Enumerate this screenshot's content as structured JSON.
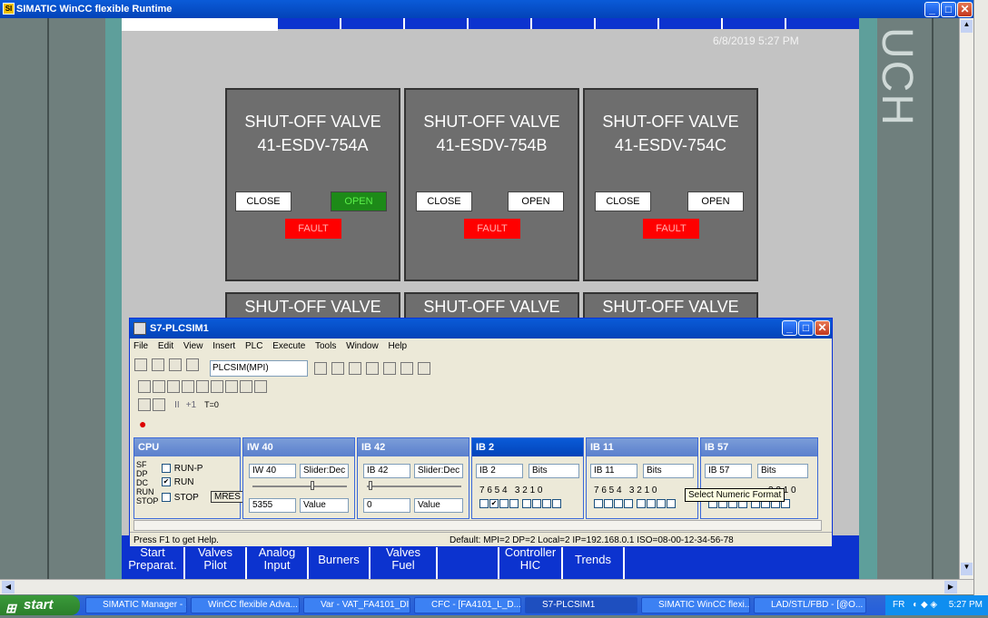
{
  "window": {
    "title": "SIMATIC WinCC flexible Runtime"
  },
  "datetime": "6/8/2019 5:27 PM",
  "side_text": "UCH",
  "valves": [
    {
      "title1": "SHUT-OFF VALVE",
      "title2": "41-ESDV-754A",
      "close": "CLOSE",
      "open": "OPEN",
      "fault": "FAULT",
      "open_active": true
    },
    {
      "title1": "SHUT-OFF VALVE",
      "title2": "41-ESDV-754B",
      "close": "CLOSE",
      "open": "OPEN",
      "fault": "FAULT",
      "open_active": false
    },
    {
      "title1": "SHUT-OFF VALVE",
      "title2": "41-ESDV-754C",
      "close": "CLOSE",
      "open": "OPEN",
      "fault": "FAULT",
      "open_active": false
    }
  ],
  "valves_row2": [
    "SHUT-OFF VALVE",
    "SHUT-OFF VALVE",
    "SHUT-OFF VALVE"
  ],
  "nav": [
    {
      "l1": "Start",
      "l2": "Preparat."
    },
    {
      "l1": "Valves",
      "l2": "Pilot"
    },
    {
      "l1": "Analog",
      "l2": "Input"
    },
    {
      "l1": "Burners",
      "l2": ""
    },
    {
      "l1": "Valves",
      "l2": "Fuel"
    },
    {
      "l1": "",
      "l2": ""
    },
    {
      "l1": "Controller",
      "l2": "HIC"
    },
    {
      "l1": "Trends",
      "l2": ""
    }
  ],
  "plcsim": {
    "title": "S7-PLCSIM1",
    "menu": [
      "File",
      "Edit",
      "View",
      "Insert",
      "PLC",
      "Execute",
      "Tools",
      "Window",
      "Help"
    ],
    "connection": "PLCSIM(MPI)",
    "cpu": {
      "title": "CPU",
      "leds": [
        "SF",
        "DP",
        "DC",
        "RUN",
        "STOP"
      ],
      "run_p": "RUN-P",
      "run": "RUN",
      "stop": "STOP",
      "mres": "MRES"
    },
    "iw40": {
      "title": "IW 40",
      "addr": "IW  40",
      "fmt": "Slider:Dec",
      "value": "5355",
      "mode": "Value"
    },
    "ib42": {
      "title": "IB 42",
      "addr": "IB  42",
      "fmt": "Slider:Dec",
      "value": "0",
      "mode": "Value"
    },
    "ib2": {
      "title": "IB 2",
      "addr": "IB  2",
      "fmt": "Bits",
      "bits": "7 6 5 4   3 2 1 0"
    },
    "ib11": {
      "title": "IB 11",
      "addr": "IB  11",
      "fmt": "Bits",
      "bits": "7 6 5 4   3 2 1 0"
    },
    "ib57": {
      "title": "IB 57",
      "addr": "IB  57",
      "fmt": "Bits",
      "bits": "3 2 1 0"
    },
    "tooltip": "Select Numeric Format",
    "status_left": "Press F1 to get Help.",
    "status_right": "Default:  MPI=2 DP=2 Local=2 IP=192.168.0.1 ISO=08-00-12-34-56-78",
    "toolbar_counter": "T=0"
  },
  "taskbar": {
    "start": "start",
    "tasks": [
      "SIMATIC Manager - ...",
      "WinCC flexible Adva...",
      "Var - VAT_FA4101_DI",
      "CFC - [FA4101_L_D...",
      "S7-PLCSIM1",
      "SIMATIC WinCC flexi...",
      "LAD/STL/FBD - [@O..."
    ],
    "lang": "FR",
    "clock": "5:27 PM"
  }
}
